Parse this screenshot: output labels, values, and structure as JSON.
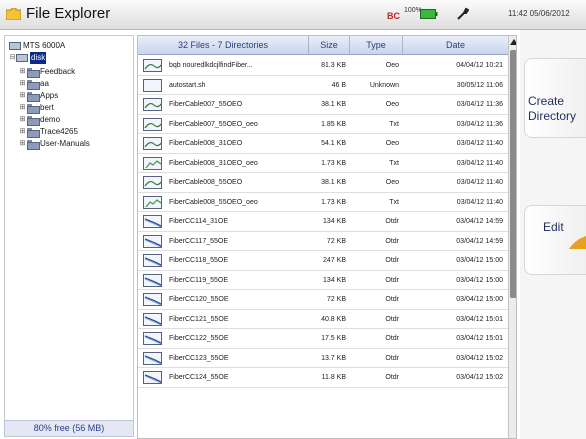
{
  "window": {
    "title": "File Explorer",
    "status_badge": "BC",
    "battery": "100%",
    "clock": "11:42  05/06/2012"
  },
  "tree": {
    "root": "MTS 6000A",
    "selected": "disk",
    "folders": [
      "Feedback",
      "aa",
      "Apps",
      "bert",
      "demo",
      "Trace4265",
      "User-Manuals"
    ],
    "free_space": "80% free (56 MB)"
  },
  "file_list": {
    "columns": [
      "32 Files - 7 Directories",
      "Size",
      "Type",
      "Date"
    ],
    "rows": [
      {
        "icon": "fiber-trace-icon",
        "name": "bqb nouredlkdcjlfindFiber...",
        "size": "81.3 KB",
        "type": "Oeo",
        "date": "04/04/12 10:21"
      },
      {
        "icon": "blank-file-icon",
        "name": "autostart.sh",
        "size": "46 B",
        "type": "Unknown",
        "date": "30/05/12 11:06"
      },
      {
        "icon": "fiber-trace-icon",
        "name": "FiberCable007_55OEO",
        "size": "38.1 KB",
        "type": "Oeo",
        "date": "03/04/12 11:36"
      },
      {
        "icon": "fiber-trace-icon",
        "name": "FiberCable007_55OEO_oeo",
        "size": "1.85 KB",
        "type": "Txt",
        "date": "03/04/12 11:36"
      },
      {
        "icon": "fiber-trace-icon",
        "name": "FiberCable008_31OEO",
        "size": "54.1 KB",
        "type": "Oeo",
        "date": "03/04/12 11:40"
      },
      {
        "icon": "text-file-icon",
        "name": "FiberCable008_31OEO_oeo",
        "size": "1.73 KB",
        "type": "Txt",
        "date": "03/04/12 11:40"
      },
      {
        "icon": "fiber-trace-icon",
        "name": "FiberCable008_55OEO",
        "size": "38.1 KB",
        "type": "Oeo",
        "date": "03/04/12 11:40"
      },
      {
        "icon": "text-file-icon",
        "name": "FiberCable008_55OEO_oeo",
        "size": "1.73 KB",
        "type": "Txt",
        "date": "03/04/12 11:40"
      },
      {
        "icon": "otdr-trace-icon",
        "name": "FiberCC114_31OE",
        "size": "134 KB",
        "type": "Otdr",
        "date": "03/04/12 14:59"
      },
      {
        "icon": "otdr-trace-icon",
        "name": "FiberCC117_55OE",
        "size": "72 KB",
        "type": "Otdr",
        "date": "03/04/12 14:59"
      },
      {
        "icon": "otdr-trace-icon",
        "name": "FiberCC118_55OE",
        "size": "247 KB",
        "type": "Otdr",
        "date": "03/04/12 15:00"
      },
      {
        "icon": "otdr-trace-icon",
        "name": "FiberCC119_55OE",
        "size": "134 KB",
        "type": "Otdr",
        "date": "03/04/12 15:00"
      },
      {
        "icon": "otdr-trace-icon",
        "name": "FiberCC120_55OE",
        "size": "72 KB",
        "type": "Otdr",
        "date": "03/04/12 15:00"
      },
      {
        "icon": "otdr-trace-icon",
        "name": "FiberCC121_55OE",
        "size": "40.8 KB",
        "type": "Otdr",
        "date": "03/04/12 15:01"
      },
      {
        "icon": "otdr-trace-icon",
        "name": "FiberCC122_55OE",
        "size": "17.5 KB",
        "type": "Otdr",
        "date": "03/04/12 15:01"
      },
      {
        "icon": "otdr-trace-icon",
        "name": "FiberCC123_55OE",
        "size": "13.7 KB",
        "type": "Otdr",
        "date": "03/04/12 15:02"
      },
      {
        "icon": "otdr-trace-icon",
        "name": "FiberCC124_55OE",
        "size": "11.8 KB",
        "type": "Otdr",
        "date": "03/04/12 15:02"
      }
    ]
  },
  "softkeys": [
    {
      "label": "Create\nDirectory"
    },
    {
      "label": "Edit"
    }
  ],
  "colors": {
    "selection": "#0b2a8c",
    "header_text": "#2c3f74",
    "softkey_text": "#1c2f5c",
    "accent_orange": "#e8a020"
  }
}
